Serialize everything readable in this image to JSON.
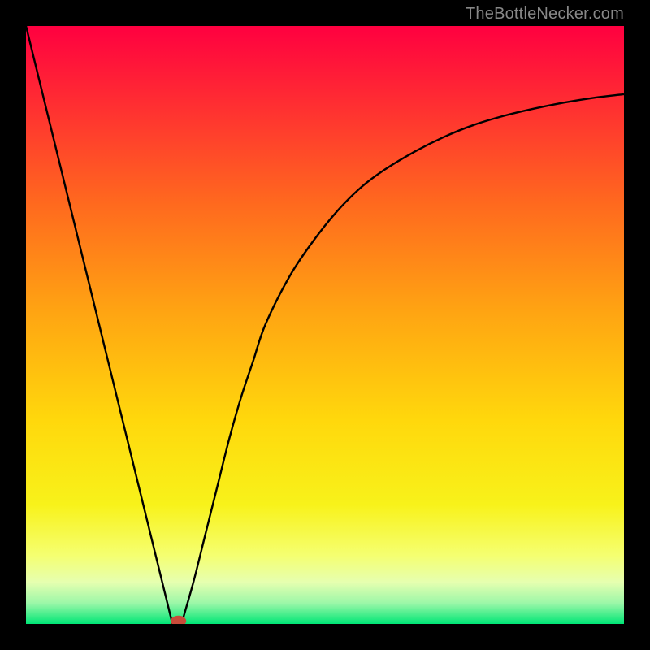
{
  "attribution": "TheBottleNecker.com",
  "chart_data": {
    "type": "line",
    "title": "",
    "xlabel": "",
    "ylabel": "",
    "xlim": [
      0,
      100
    ],
    "ylim": [
      0,
      100
    ],
    "grid": false,
    "legend": false,
    "background_gradient": {
      "stops": [
        {
          "offset": 0.0,
          "color": "#ff0040"
        },
        {
          "offset": 0.12,
          "color": "#ff2a33"
        },
        {
          "offset": 0.3,
          "color": "#ff6a1e"
        },
        {
          "offset": 0.48,
          "color": "#ffa512"
        },
        {
          "offset": 0.66,
          "color": "#ffd80c"
        },
        {
          "offset": 0.8,
          "color": "#f8f21a"
        },
        {
          "offset": 0.885,
          "color": "#f5ff70"
        },
        {
          "offset": 0.93,
          "color": "#e6ffb0"
        },
        {
          "offset": 0.965,
          "color": "#9cf7a8"
        },
        {
          "offset": 1.0,
          "color": "#00e676"
        }
      ]
    },
    "series": [
      {
        "name": "left-line",
        "x": [
          0,
          24.5
        ],
        "y": [
          100,
          0
        ]
      },
      {
        "name": "right-curve",
        "x": [
          26,
          28,
          30,
          32,
          34,
          36,
          38,
          40,
          44,
          48,
          52,
          56,
          60,
          65,
          70,
          75,
          80,
          85,
          90,
          95,
          100
        ],
        "y": [
          0,
          7,
          15,
          23,
          31,
          38,
          44,
          50,
          58,
          64,
          69,
          73,
          76,
          79,
          81.5,
          83.5,
          85,
          86.2,
          87.2,
          88,
          88.6
        ]
      }
    ],
    "marker": {
      "x": 25.5,
      "y": 0.5,
      "rx": 1.3,
      "ry": 0.9,
      "color": "#c94b3a"
    }
  }
}
